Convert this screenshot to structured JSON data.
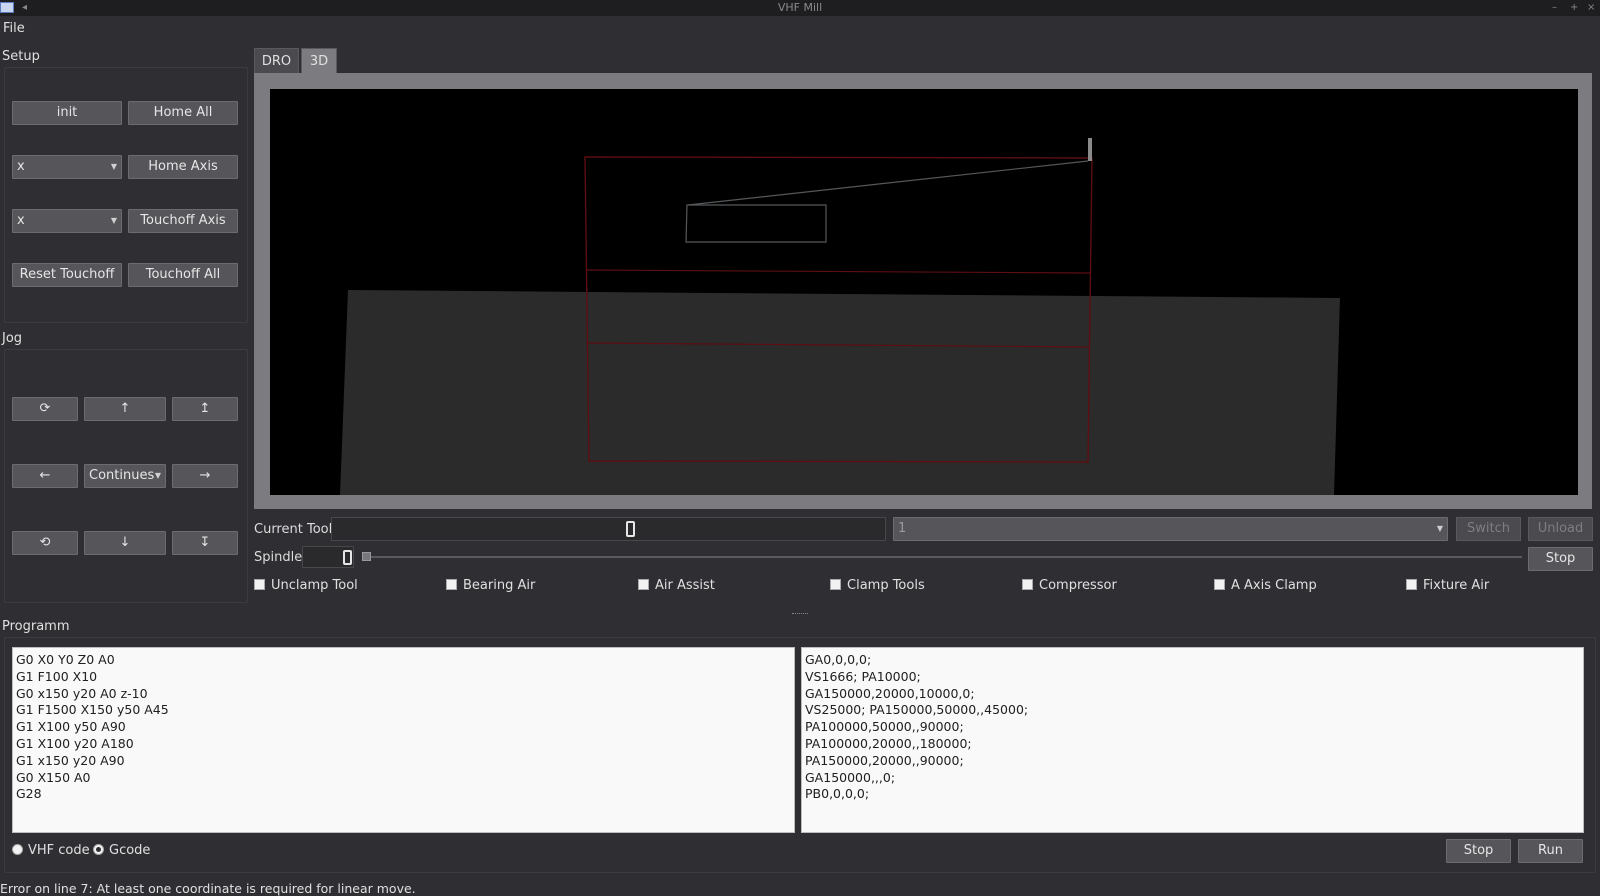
{
  "window": {
    "title": "VHF Mill"
  },
  "menu": {
    "file": "File"
  },
  "setup": {
    "label": "Setup",
    "init": "init",
    "home_all": "Home All",
    "axis_select_1": "x",
    "home_axis": "Home Axis",
    "axis_select_2": "x",
    "touchoff_axis": "Touchoff Axis",
    "reset_touchoff": "Reset Touchoff",
    "touchoff_all": "Touchoff All"
  },
  "jog": {
    "label": "Jog",
    "rotate_cw": "⟳",
    "up": "↑",
    "z_up": "↥",
    "left": "←",
    "mode": "Continues",
    "right": "→",
    "rotate_ccw": "⟲",
    "down": "↓",
    "z_down": "↧"
  },
  "tabs": [
    {
      "label": "DRO"
    },
    {
      "label": "3D"
    }
  ],
  "tool": {
    "label": "Current Tool",
    "select_value": "1",
    "switch": "Switch",
    "unload": "Unload"
  },
  "spindle": {
    "label": "Spindle",
    "stop": "Stop"
  },
  "checkboxes": [
    {
      "label": "Unclamp Tool"
    },
    {
      "label": "Bearing Air"
    },
    {
      "label": "Air Assist"
    },
    {
      "label": "Clamp Tools"
    },
    {
      "label": "Compressor"
    },
    {
      "label": "A Axis Clamp"
    },
    {
      "label": "Fixture Air"
    }
  ],
  "program": {
    "label": "Programm",
    "gcode_lines": [
      "G0 X0 Y0 Z0 A0",
      "G1 F100 X10",
      "G0 x150 y20 A0 z-10",
      "G1 F1500 X150 y50 A45",
      "G1 X100 y50 A90",
      "G1 X100 y20 A180",
      "G1 x150 y20 A90",
      "G0 X150 A0",
      "G28"
    ],
    "vhf_lines": [
      "GA0,0,0,0;",
      "VS1666; PA10000;",
      "GA150000,20000,10000,0;",
      "VS25000; PA150000,50000,,45000;",
      "PA100000,50000,,90000;",
      "PA100000,20000,,180000;",
      "PA150000,20000,,90000;",
      "GA150000,,,0;",
      "PB0,0,0,0;"
    ],
    "radio_vhf": "VHF code",
    "radio_gcode": "Gcode",
    "selected": "Gcode",
    "stop": "Stop",
    "run": "Run"
  },
  "status": {
    "message": "Error on line 7: At least one coordinate is required for linear move."
  }
}
